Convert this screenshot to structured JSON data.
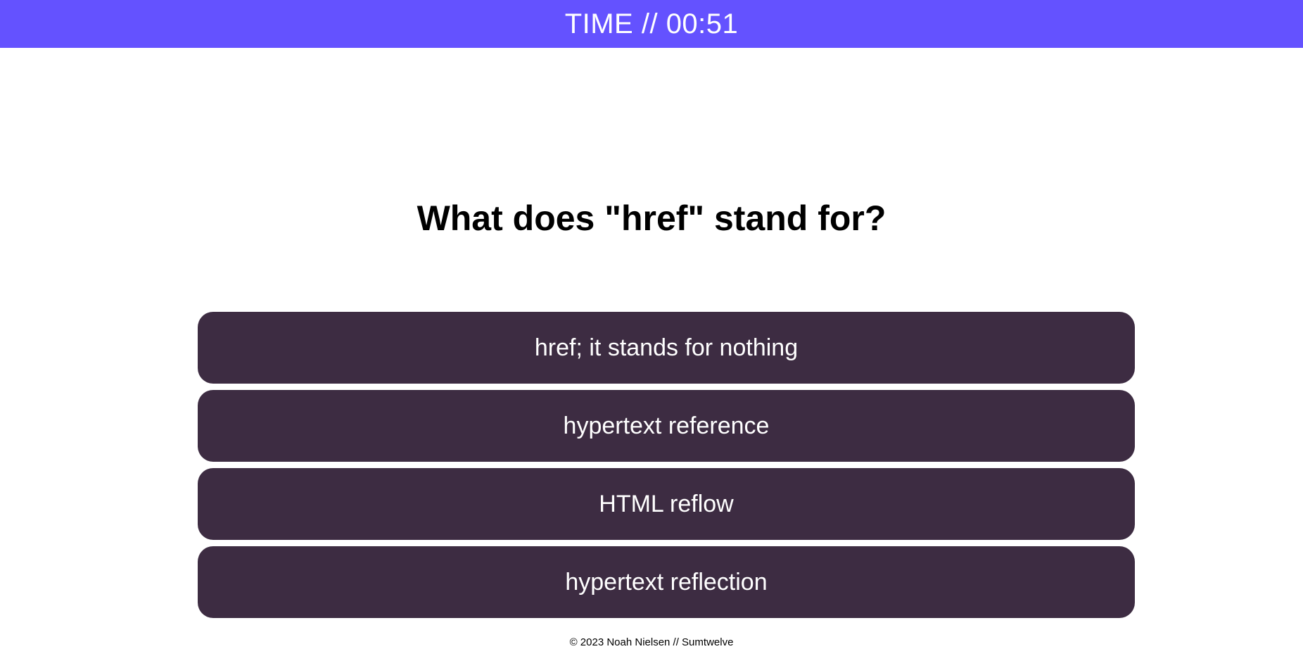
{
  "timer": {
    "text": "TIME // 00:51"
  },
  "quiz": {
    "question": "What does \"href\" stand for?",
    "answers": [
      "href; it stands for nothing",
      "hypertext reference",
      "HTML reflow",
      "hypertext reflection"
    ]
  },
  "footer": {
    "text": "© 2023 Noah Nielsen // Sumtwelve"
  },
  "colors": {
    "header_bg": "#6452ff",
    "answer_bg": "#3d2c42",
    "answer_text": "#ffffff"
  }
}
